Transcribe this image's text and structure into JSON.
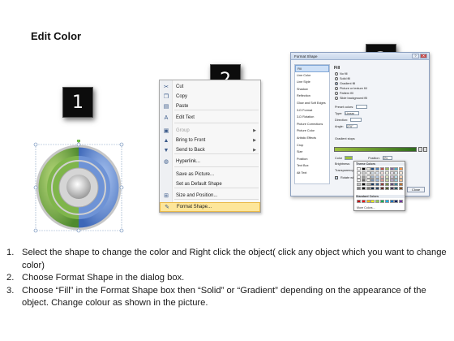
{
  "title": "Edit Color",
  "steps": {
    "one": "1",
    "two": "2",
    "three": "3"
  },
  "context_menu": {
    "items": [
      {
        "label": "Cut",
        "icon": "scissors-icon",
        "glyph": "✂",
        "enabled": true
      },
      {
        "label": "Copy",
        "icon": "copy-icon",
        "glyph": "❐",
        "enabled": true
      },
      {
        "label": "Paste",
        "icon": "paste-icon",
        "glyph": "▤",
        "enabled": true
      },
      {
        "label": "Edit Text",
        "icon": "edit-text-icon",
        "glyph": "A",
        "enabled": true
      },
      {
        "label": "Group",
        "icon": "group-icon",
        "glyph": "▣",
        "enabled": false,
        "submenu": true
      },
      {
        "label": "Bring to Front",
        "icon": "bring-front-icon",
        "glyph": "▲",
        "enabled": true,
        "submenu": true
      },
      {
        "label": "Send to Back",
        "icon": "send-back-icon",
        "glyph": "▼",
        "enabled": true,
        "submenu": true
      },
      {
        "label": "Hyperlink...",
        "icon": "hyperlink-icon",
        "glyph": "◍",
        "enabled": true
      },
      {
        "label": "Save as Picture...",
        "icon": "",
        "glyph": "",
        "enabled": true
      },
      {
        "label": "Set as Default Shape",
        "icon": "",
        "glyph": "",
        "enabled": true
      },
      {
        "label": "Size and Position...",
        "icon": "size-position-icon",
        "glyph": "⊞",
        "enabled": true
      },
      {
        "label": "Format Shape...",
        "icon": "format-shape-icon",
        "glyph": "✎",
        "enabled": true,
        "highlighted": true
      }
    ]
  },
  "dialog": {
    "title": "Format Shape",
    "categories": [
      "Fill",
      "Line Color",
      "Line Style",
      "Shadow",
      "Reflection",
      "Glow and Soft Edges",
      "3-D Format",
      "3-D Rotation",
      "Picture Corrections",
      "Picture Color",
      "Artistic Effects",
      "Crop",
      "Size",
      "Position",
      "Text Box",
      "Alt Text"
    ],
    "selected_category": "Fill",
    "section_heading": "Fill",
    "fill_options": [
      {
        "label": "No fill",
        "selected": false
      },
      {
        "label": "Solid fill",
        "selected": false
      },
      {
        "label": "Gradient fill",
        "selected": true
      },
      {
        "label": "Picture or texture fill",
        "selected": false
      },
      {
        "label": "Pattern fill",
        "selected": false
      },
      {
        "label": "Slide background fill",
        "selected": false
      }
    ],
    "preset_label": "Preset colors:",
    "type_label": "Type:",
    "type_value": "Linear",
    "direction_label": "Direction:",
    "angle_label": "Angle:",
    "angle_value": "270°",
    "gradient_stops_label": "Gradient stops",
    "color_label": "Color",
    "position_label": "Position:",
    "position_value": "0%",
    "brightness_label": "Brightness:",
    "transparency_label": "Transparency:",
    "rotate_label": "Rotate with shape",
    "close_label": "Close"
  },
  "color_popup": {
    "theme_label": "Theme Colors",
    "standard_label": "Standard Colors",
    "more_label": "More Colors...",
    "theme_top": [
      "#ffffff",
      "#000000",
      "#eeece1",
      "#1f497d",
      "#4f81bd",
      "#c0504d",
      "#9bbb59",
      "#8064a2",
      "#4bacc6",
      "#f79646"
    ],
    "standard": [
      "#c00000",
      "#ff0000",
      "#ffc000",
      "#ffff00",
      "#92d050",
      "#00b050",
      "#00b0f0",
      "#0070c0",
      "#002060",
      "#7030a0"
    ]
  },
  "instructions": [
    {
      "num": "1.",
      "text": "Select the shape to change the color and Right click the object( click any object which you want to change color)"
    },
    {
      "num": "2.",
      "text": "Choose Format Shape in the dialog box."
    },
    {
      "num": "3.",
      "text": "Choose “Fill” in the Format Shape box then “Solid” or “Gradient” depending on the appearance of the object. Change colour as shown in the picture."
    }
  ]
}
